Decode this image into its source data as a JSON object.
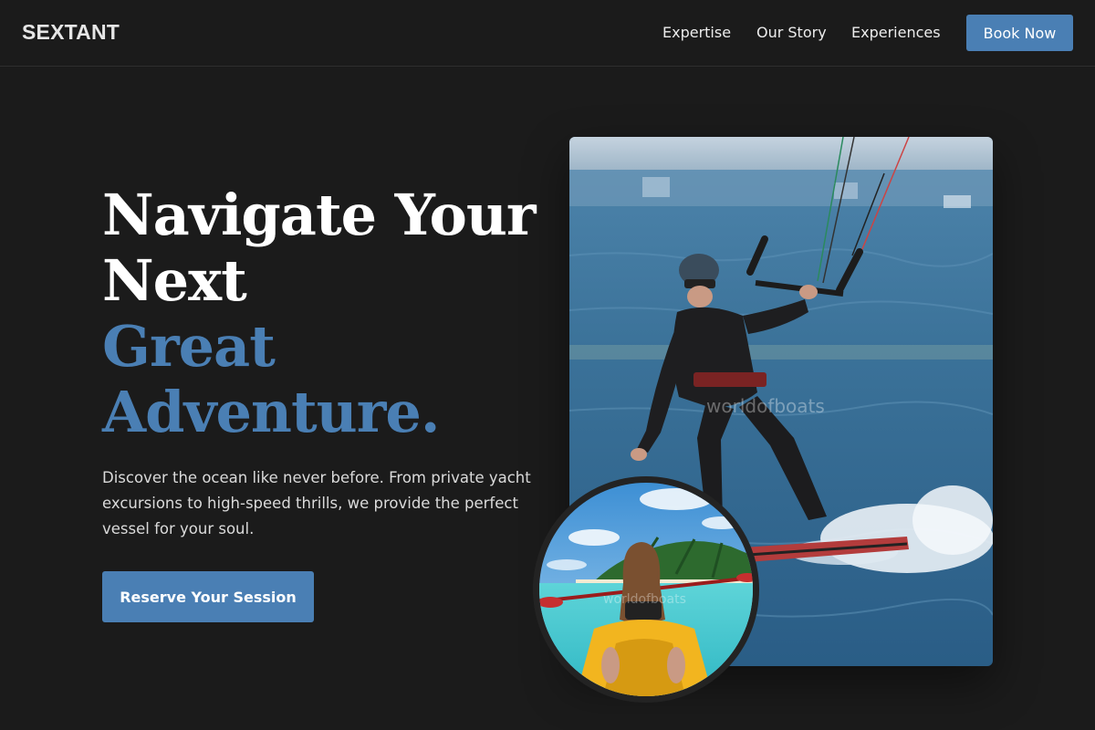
{
  "header": {
    "logo": "SEXTANT",
    "nav": [
      "Expertise",
      "Our Story",
      "Experiences"
    ],
    "cta_label": "Book Now"
  },
  "hero": {
    "title_line1": "Navigate Your",
    "title_line2": "Next",
    "title_line3": "Great",
    "title_line4": "Adventure.",
    "description": "Discover the ocean like never before. From private yacht excursions to high-speed thrills, we provide the perfect vessel for your soul.",
    "cta_label": "Reserve Your Session"
  },
  "images": {
    "main_watermark": "worldofboats",
    "circle_watermark": "worldofboats"
  },
  "colors": {
    "background": "#1b1b1b",
    "accent": "#4a7fb4",
    "text": "#ffffff"
  }
}
